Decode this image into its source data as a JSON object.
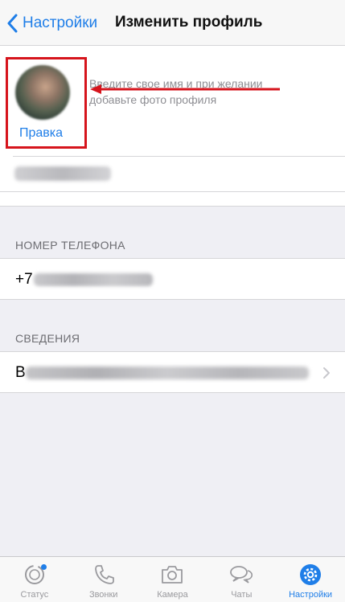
{
  "navbar": {
    "back_label": "Настройки",
    "title": "Изменить профиль"
  },
  "profile": {
    "edit_label": "Правка",
    "hint": "Введите свое имя и при желании добавьте фото профиля"
  },
  "phone_section": {
    "header": "НОМЕР ТЕЛЕФОНА",
    "prefix": "+7"
  },
  "about_section": {
    "header": "СВЕДЕНИЯ",
    "visible_char": "В"
  },
  "tabbar": {
    "tabs": [
      {
        "label": "Статус",
        "icon": "status-icon"
      },
      {
        "label": "Звонки",
        "icon": "phone-icon"
      },
      {
        "label": "Камера",
        "icon": "camera-icon"
      },
      {
        "label": "Чаты",
        "icon": "chats-icon"
      },
      {
        "label": "Настройки",
        "icon": "settings-icon",
        "active": true
      }
    ]
  },
  "colors": {
    "accent": "#1f7ee8",
    "annotation": "#d6141c",
    "background": "#efeff4"
  }
}
